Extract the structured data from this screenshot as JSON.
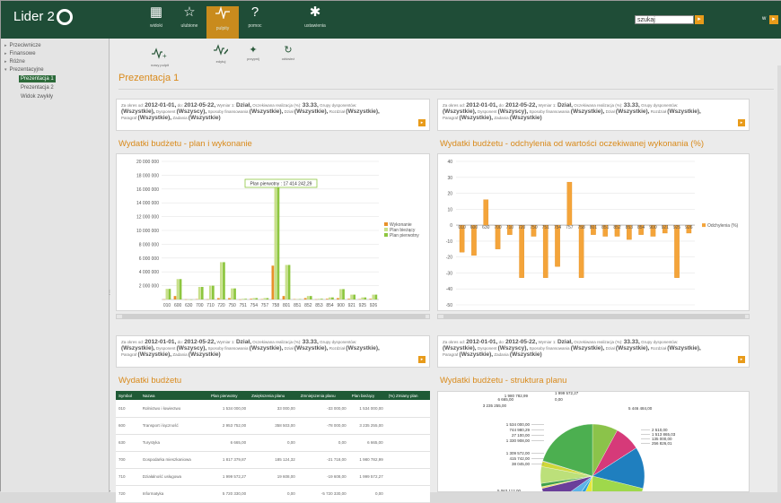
{
  "app": {
    "logo_text": "Lider 2"
  },
  "nav": [
    {
      "label": "widoki",
      "icon": "grid-icon"
    },
    {
      "label": "ulubione",
      "icon": "star-icon"
    },
    {
      "label": "pulpity",
      "icon": "pulse-icon",
      "active": true
    },
    {
      "label": "pomoc",
      "icon": "question-icon"
    },
    {
      "label": "ustawienia",
      "icon": "gear-icon"
    }
  ],
  "search": {
    "value": "szukaj"
  },
  "user": {
    "initial": "w"
  },
  "sidebar": {
    "items": [
      {
        "label": "Przeciwnicze",
        "level": 0
      },
      {
        "label": "Finansowe",
        "level": 0
      },
      {
        "label": "Różne",
        "level": 0
      },
      {
        "label": "Prezentacyjne",
        "level": 0
      },
      {
        "label": "Prezentacja 1",
        "level": 1,
        "selected": true
      },
      {
        "label": "Prezentacja 2",
        "level": 1
      },
      {
        "label": "Widok zwykły",
        "level": 1
      }
    ]
  },
  "toolbar": {
    "new_label": "nowy pulpit",
    "items": [
      {
        "label": "edytuj"
      },
      {
        "label": "przypnij"
      },
      {
        "label": "odśwież"
      }
    ]
  },
  "page": {
    "title": "Prezentacja 1"
  },
  "filter": {
    "prefix_from": "Za okres od:",
    "date_from": "2012-01-01,",
    "prefix_to": "do:",
    "date_to": "2012-05-22,",
    "dim_label": "Wymiar 1:",
    "dim_value": "Dział,",
    "exp_label": "Oczekiwana realizacja (%):",
    "exp_value": "33.33,",
    "groups_label": "Grupy dysponentów:",
    "all": "(Wszystkie),",
    "disp_label": "Dysponent",
    "disp_value": "(Wszyscy),",
    "fin_label": "Sposoby finansowania",
    "fin_value": "(Wszystkie),",
    "dzial_label": "Dział",
    "dzial_value": "(Wszystkie),",
    "rozdz_label": "Rozdział",
    "rozdz_value": "(Wszystkie),",
    "par_label": "Paragraf",
    "par_value": "(Wszystkie),",
    "zad_label": "Zadania",
    "zad_value": "(Wszystkie)"
  },
  "panels": {
    "bar_title": "Wydatki budżetu - plan i wykonanie",
    "dev_title": "Wydatki budżetu - odchylenia od wartości oczekiwanej wykonania (%)",
    "table_title": "Wydatki budżetu",
    "pie_title": "Wydatki budżetu - struktura planu"
  },
  "chart_data": [
    {
      "type": "bar",
      "title": "Wydatki budżetu - plan i wykonanie",
      "categories": [
        "010",
        "600",
        "630",
        "700",
        "710",
        "720",
        "750",
        "751",
        "754",
        "757",
        "758",
        "801",
        "851",
        "852",
        "853",
        "854",
        "900",
        "921",
        "925",
        "926"
      ],
      "series": [
        {
          "name": "Wykonanie",
          "color": "#e8912a",
          "values": [
            30000,
            500000,
            20000,
            50000,
            30000,
            200000,
            200000,
            10000,
            100000,
            50000,
            4900000,
            500000,
            50000,
            200000,
            30000,
            100000,
            200000,
            100000,
            50000,
            100000
          ]
        },
        {
          "name": "Plan bieżący",
          "color": "#c8e08a",
          "values": [
            1534000,
            2954000,
            6000,
            1817000,
            2000000,
            5400000,
            1600000,
            100000,
            200000,
            200000,
            17414000,
            5000000,
            50000,
            500000,
            100000,
            300000,
            1500000,
            700000,
            300000,
            700000
          ]
        },
        {
          "name": "Plan pierwotny",
          "color": "#8dc63f",
          "values": [
            1534000,
            2954000,
            6000,
            1817000,
            2000000,
            5400000,
            1600000,
            100000,
            200000,
            200000,
            17414242.29,
            5000000,
            50000,
            500000,
            100000,
            300000,
            1500000,
            700000,
            300000,
            700000
          ]
        }
      ],
      "ylim": [
        0,
        20000000
      ],
      "yticks": [
        "2 000 000",
        "4 000 000",
        "6 000 000",
        "8 000 000",
        "10 000 000",
        "12 000 000",
        "14 000 000",
        "16 000 000",
        "18 000 000",
        "20 000 000"
      ],
      "tooltip": "Plan pierwotny : 17 414 242,29",
      "legend": "right"
    },
    {
      "type": "bar",
      "title": "Wydatki budżetu - odchylenia od wartości oczekiwanej wykonania (%)",
      "categories": [
        "010",
        "600",
        "630",
        "700",
        "710",
        "720",
        "750",
        "751",
        "754",
        "757",
        "758",
        "801",
        "851",
        "852",
        "853",
        "854",
        "900",
        "921",
        "925",
        "926"
      ],
      "series": [
        {
          "name": "Odchylenia (%)",
          "color": "#f4a43a",
          "values": [
            -17,
            -19,
            16,
            -15,
            -6,
            -33,
            -7,
            -33,
            -26,
            27,
            -33,
            -6,
            -7,
            -7,
            -9,
            -6,
            -7,
            -5,
            -33,
            -5
          ]
        }
      ],
      "ylim": [
        -50,
        40
      ],
      "yticks": [
        "-50",
        "-40",
        "-30",
        "-20",
        "-10",
        "0",
        "10",
        "20",
        "30",
        "40"
      ],
      "legend": "right"
    },
    {
      "type": "table",
      "title": "Wydatki budżetu",
      "columns": [
        "Symbol",
        "Nazwa",
        "Plan pierwotny",
        "Zwiększenia planu",
        "Zmniejszenia planu",
        "Plan bieżący",
        "(%) Zmiany plan"
      ],
      "rows": [
        [
          "010",
          "Rolnictwo i łowiectwo",
          "1 534 000,00",
          "33 000,00",
          "-33 000,00",
          "1 534 000,00",
          ""
        ],
        [
          "600",
          "Transport i łączność",
          "2 953 752,00",
          "358 503,00",
          "-78 000,00",
          "3 235 255,00",
          ""
        ],
        [
          "630",
          "Turystyka",
          "6 665,00",
          "0,00",
          "0,00",
          "6 665,00",
          ""
        ],
        [
          "700",
          "Gospodarka mieszkaniowa",
          "1 817 379,87",
          "185 124,32",
          "-21 718,00",
          "1 980 782,99",
          ""
        ],
        [
          "710",
          "Działalność usługowa",
          "1 999 572,27",
          "19 608,00",
          "-19 608,00",
          "1 999 572,27",
          ""
        ],
        [
          "720",
          "Informatyka",
          "5 720 330,00",
          "0,00",
          "-5 720 330,00",
          "0,00",
          ""
        ]
      ]
    },
    {
      "type": "pie",
      "title": "Wydatki budżetu - struktura planu",
      "labels": [
        "1 980 782,99",
        "1 999 572,27",
        "0,00",
        "6 665,00",
        "3 235 255,00",
        "5 446 484,00",
        "1 534 000,00",
        "744 980,29",
        "27 100,00",
        "1 330 908,00",
        "2 510,00",
        "1 513 865,03",
        "135 000,00",
        "256 826,01",
        "1 309 572,00",
        "415 742,00",
        "38 045,00",
        "5 063 112,00"
      ],
      "values": [
        1980782.99,
        1999572.27,
        6665,
        3235255,
        5446484,
        1534000,
        744980.29,
        27100,
        1330908,
        2510,
        1513865.03,
        135000,
        256826.01,
        1309572,
        415742,
        38045,
        5063112
      ],
      "colors": [
        "#8bc34a",
        "#d63a79",
        "#3f7f3f",
        "#1f7fbf",
        "#9fd84b",
        "#e5e83a",
        "#2fa0d8",
        "#f0c23a",
        "#5db3e8",
        "#e8912a",
        "#6a3f9a",
        "#f0e26a",
        "#3fa04a",
        "#bce07a",
        "#d0d83a",
        "#8a6fd0",
        "#4caf50"
      ]
    }
  ]
}
